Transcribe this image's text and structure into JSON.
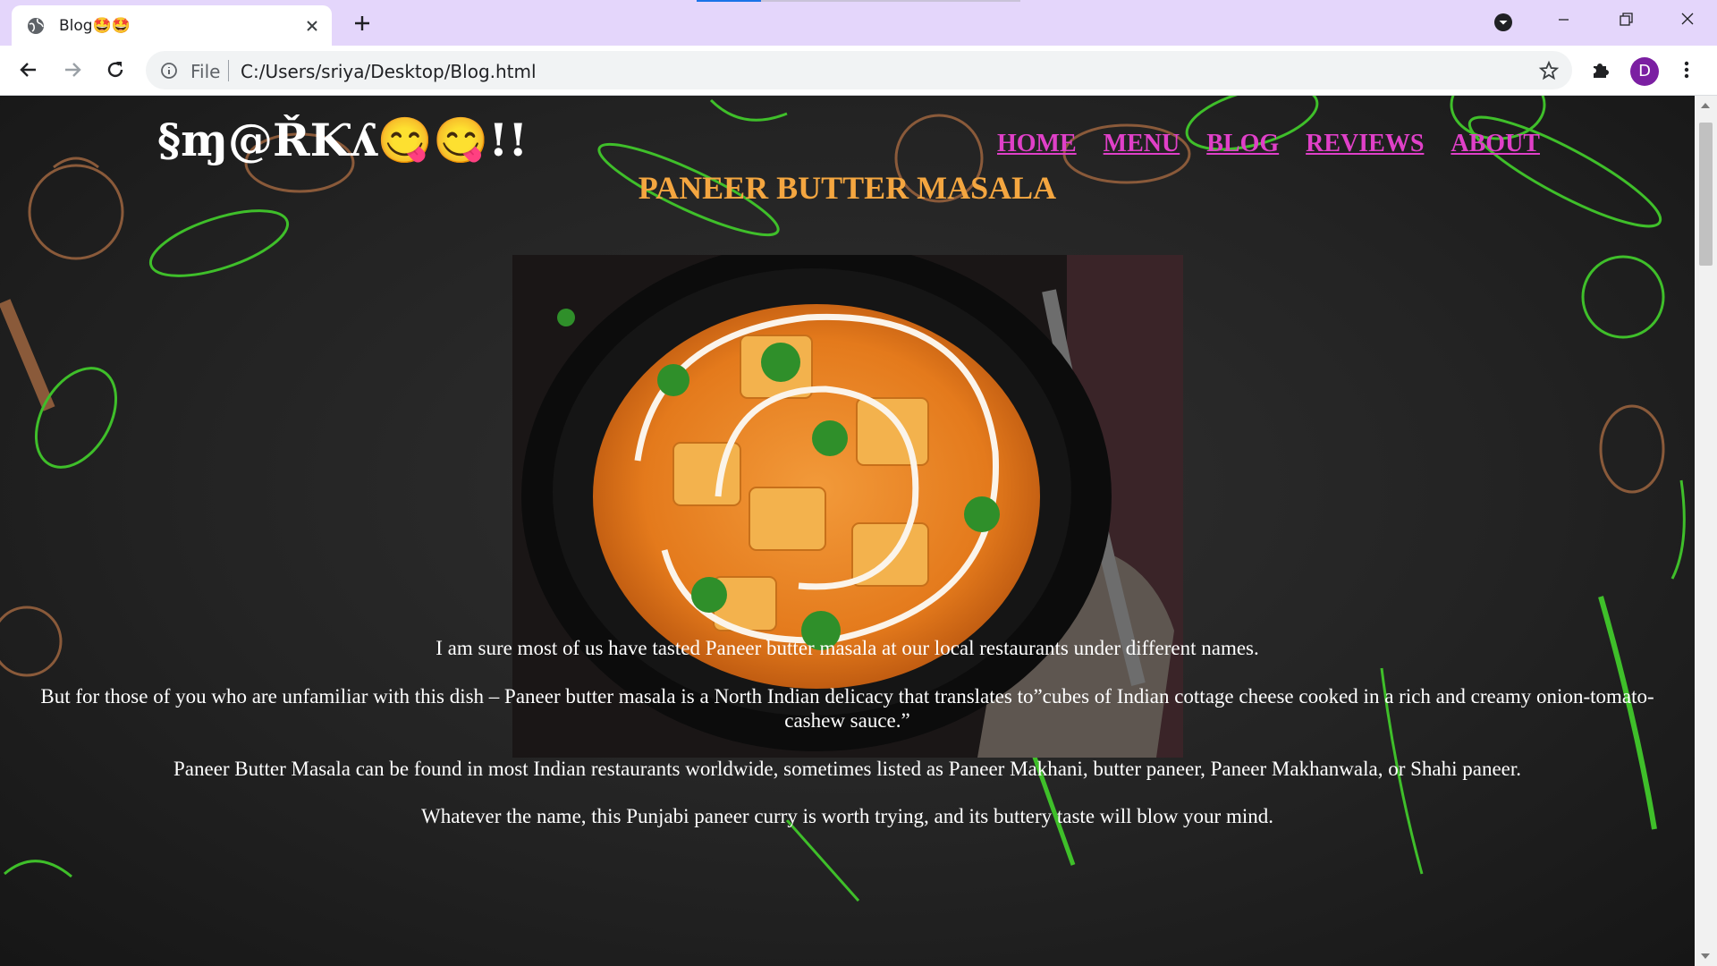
{
  "browser": {
    "tab": {
      "title": "Blog🤩🤩"
    },
    "address_bar": {
      "scheme_label": "File",
      "url": "C:/Users/sriya/Desktop/Blog.html"
    },
    "profile_initial": "D"
  },
  "site": {
    "logo": "§ɱ@ŘƘʎ😋😋!!",
    "nav": [
      "HOME",
      "MENU",
      "BLOG",
      "REVIEWS",
      "ABOUT"
    ],
    "title": "PANEER BUTTER MASALA",
    "image_alt_name": "paneer-butter-masala-photo",
    "paragraphs": [
      "I am sure most of us have tasted Paneer butter masala at our local restaurants under different names.",
      "But for those of you who are unfamiliar with this dish – Paneer butter masala is a North Indian delicacy that translates to”cubes of Indian cottage cheese cooked in a rich and creamy onion-tomato-cashew sauce.”",
      "Paneer Butter Masala can be found in most Indian restaurants worldwide, sometimes listed as Paneer Makhani, butter paneer, Paneer Makhanwala, or Shahi paneer.",
      "Whatever the name, this Punjabi paneer curry is worth trying, and its buttery taste will blow your mind."
    ]
  },
  "colors": {
    "nav_link": "#e040c8",
    "heading": "#f4a640",
    "tabstrip": "#e4d6fb",
    "doodle_green": "#3fbf2a",
    "doodle_brown": "#8a5a3a"
  }
}
